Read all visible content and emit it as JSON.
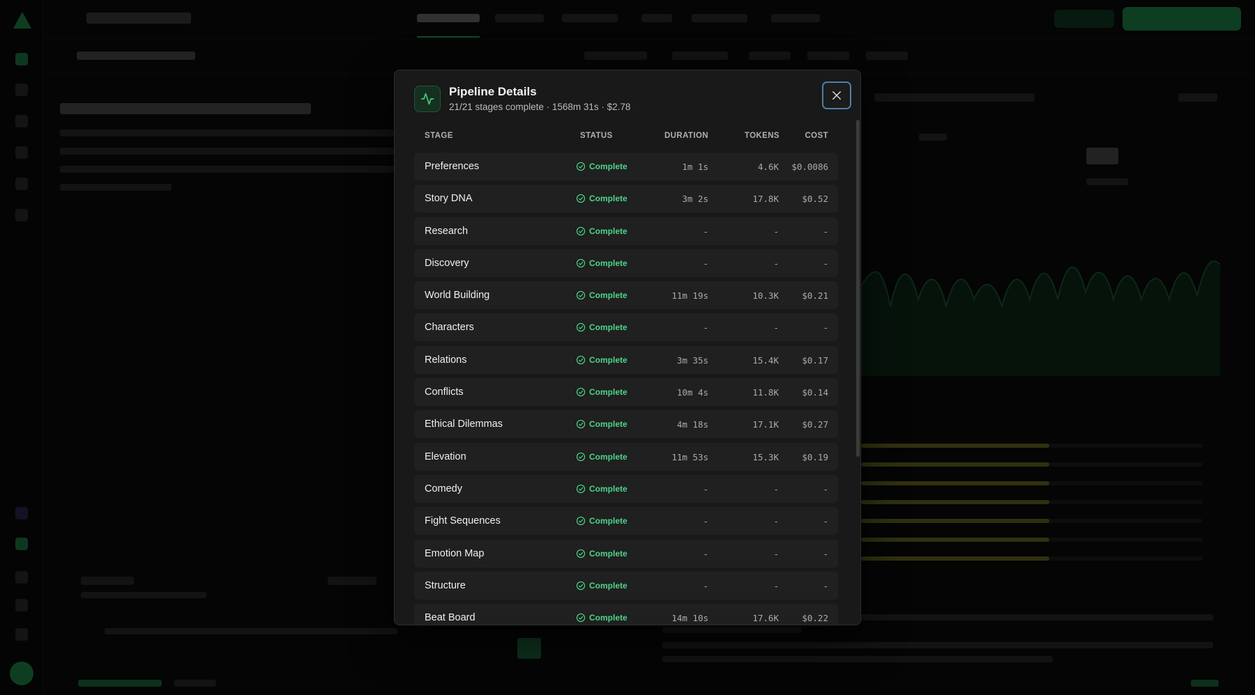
{
  "modal": {
    "title": "Pipeline Details",
    "subtitle": "21/21 stages complete · 1568m 31s · $2.78",
    "columns": {
      "stage": "STAGE",
      "status": "STATUS",
      "duration": "DURATION",
      "tokens": "TOKENS",
      "cost": "COST"
    },
    "rows": [
      {
        "stage": "Preferences",
        "status": "Complete",
        "duration": "1m 1s",
        "tokens": "4.6K",
        "cost": "$0.0086"
      },
      {
        "stage": "Story DNA",
        "status": "Complete",
        "duration": "3m 2s",
        "tokens": "17.8K",
        "cost": "$0.52"
      },
      {
        "stage": "Research",
        "status": "Complete",
        "duration": "-",
        "tokens": "-",
        "cost": "-"
      },
      {
        "stage": "Discovery",
        "status": "Complete",
        "duration": "-",
        "tokens": "-",
        "cost": "-"
      },
      {
        "stage": "World Building",
        "status": "Complete",
        "duration": "11m 19s",
        "tokens": "10.3K",
        "cost": "$0.21"
      },
      {
        "stage": "Characters",
        "status": "Complete",
        "duration": "-",
        "tokens": "-",
        "cost": "-"
      },
      {
        "stage": "Relations",
        "status": "Complete",
        "duration": "3m 35s",
        "tokens": "15.4K",
        "cost": "$0.17"
      },
      {
        "stage": "Conflicts",
        "status": "Complete",
        "duration": "10m 4s",
        "tokens": "11.8K",
        "cost": "$0.14"
      },
      {
        "stage": "Ethical Dilemmas",
        "status": "Complete",
        "duration": "4m 18s",
        "tokens": "17.1K",
        "cost": "$0.27"
      },
      {
        "stage": "Elevation",
        "status": "Complete",
        "duration": "11m 53s",
        "tokens": "15.3K",
        "cost": "$0.19"
      },
      {
        "stage": "Comedy",
        "status": "Complete",
        "duration": "-",
        "tokens": "-",
        "cost": "-"
      },
      {
        "stage": "Fight Sequences",
        "status": "Complete",
        "duration": "-",
        "tokens": "-",
        "cost": "-"
      },
      {
        "stage": "Emotion Map",
        "status": "Complete",
        "duration": "-",
        "tokens": "-",
        "cost": "-"
      },
      {
        "stage": "Structure",
        "status": "Complete",
        "duration": "-",
        "tokens": "-",
        "cost": "-"
      },
      {
        "stage": "Beat Board",
        "status": "Complete",
        "duration": "14m 10s",
        "tokens": "17.6K",
        "cost": "$0.22"
      }
    ]
  },
  "icons": {
    "header": "activity-pulse-icon",
    "close": "close-icon",
    "status": "check-circle-icon"
  },
  "colors": {
    "accent_green": "#4ed48b",
    "modal_bg": "#181918",
    "row_bg": "#1f201f",
    "close_focus": "#4c7fa8"
  }
}
